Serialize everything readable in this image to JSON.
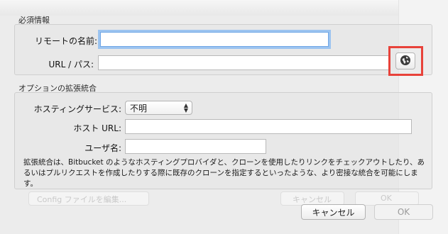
{
  "sections": {
    "required_title": "必須情報",
    "optional_title": "オプションの拡張統合"
  },
  "fields": {
    "remote_name_label": "リモートの名前:",
    "remote_name_value": "",
    "url_label": "URL / パス:",
    "url_value": "",
    "hosting_label": "ホスティングサービス:",
    "hosting_value": "不明",
    "host_url_label": "ホスト URL:",
    "host_url_value": "",
    "username_label": "ユーザ名:",
    "username_value": ""
  },
  "note": "拡張統合は、Bitbucket のようなホスティングプロバイダと、クローンを使用したりリンクをチェックアウトしたり、あるいはプルリクエストを作成したりする際に既存のクローンを指定するといったような、より密接な統合を可能にします。",
  "buttons": {
    "cancel": "キャンセル",
    "ok": "OK"
  },
  "background": {
    "ghost_config": "Config ファイルを編集...",
    "ghost_cancel": "キャンセル",
    "ghost_ok": "OK"
  },
  "colors": {
    "highlight": "#e8423a",
    "focus_ring": "#9cc4f0"
  }
}
